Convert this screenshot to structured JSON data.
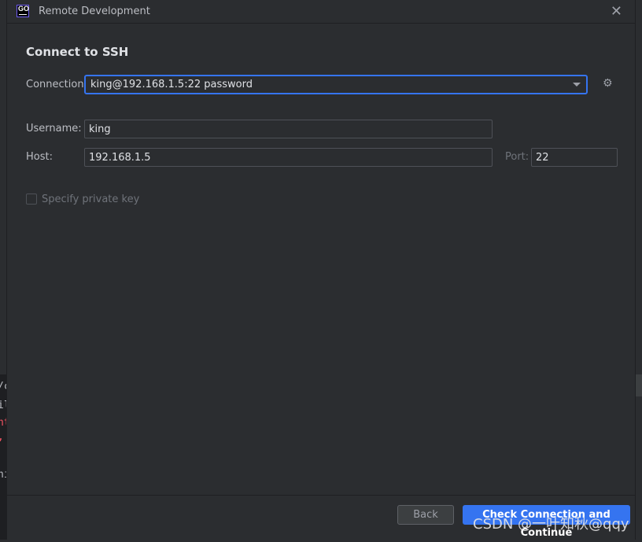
{
  "window": {
    "title": "Remote Development",
    "app_icon_text": "GO"
  },
  "heading": "Connect to SSH",
  "connection": {
    "label": "Connection:",
    "value": "king@192.168.1.5:22 password"
  },
  "username": {
    "label": "Username:",
    "value": "king"
  },
  "host": {
    "label": "Host:",
    "value": "192.168.1.5"
  },
  "port": {
    "label": "Port:",
    "value": "22"
  },
  "private_key": {
    "label": "Specify private key",
    "checked": false
  },
  "buttons": {
    "back": "Back",
    "primary": "Check Connection and Continue"
  },
  "background_code": [
    "/c",
    "il",
    "nt",
    ",",
    "ni"
  ],
  "watermark": "CSDN @一叶知秋@qqy",
  "colors": {
    "accent": "#3574f0",
    "background": "#2b2d30",
    "text": "#bcbec4"
  }
}
